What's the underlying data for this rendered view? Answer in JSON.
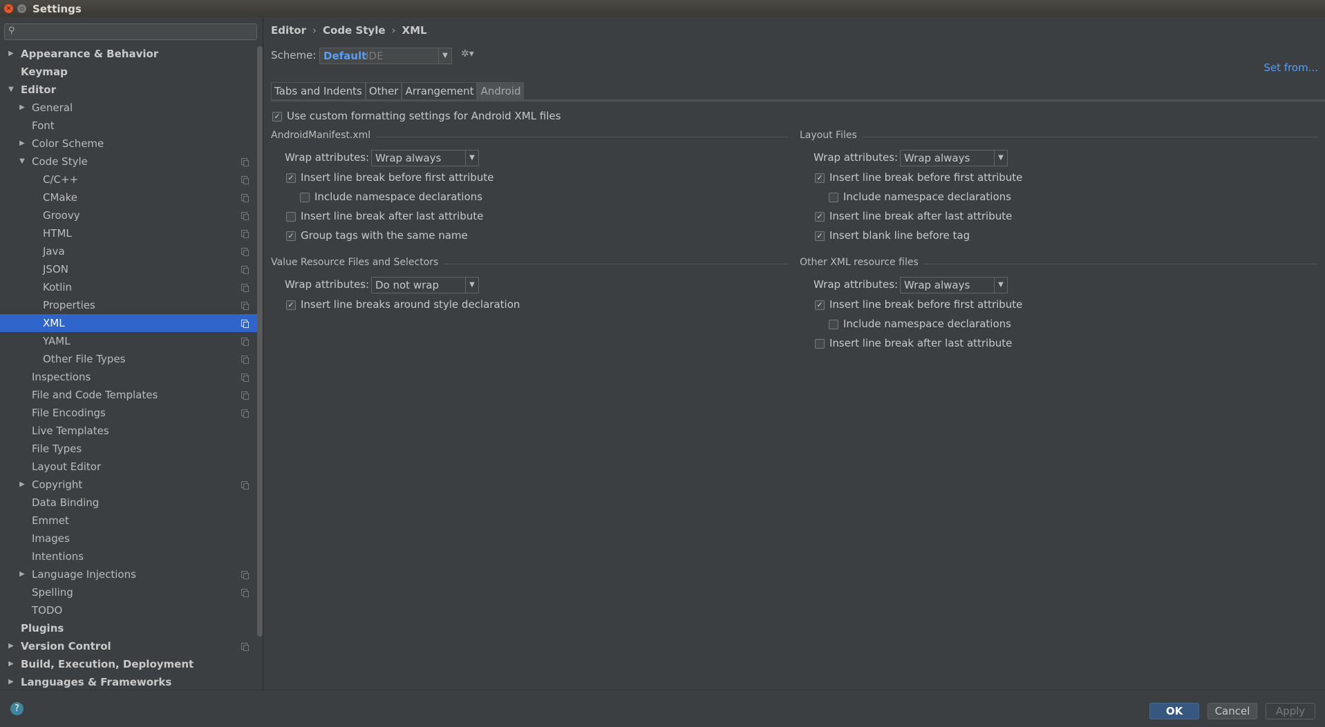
{
  "window": {
    "title": "Settings"
  },
  "search": {
    "placeholder": ""
  },
  "sidebar": {
    "items": [
      {
        "label": "Appearance & Behavior",
        "level": 0,
        "arrow": "right",
        "bold": true,
        "icon": false
      },
      {
        "label": "Keymap",
        "level": 0,
        "arrow": "",
        "bold": true,
        "icon": false
      },
      {
        "label": "Editor",
        "level": 0,
        "arrow": "down",
        "bold": true,
        "icon": false
      },
      {
        "label": "General",
        "level": 1,
        "arrow": "right",
        "bold": false,
        "icon": false
      },
      {
        "label": "Font",
        "level": 1,
        "arrow": "",
        "bold": false,
        "icon": false
      },
      {
        "label": "Color Scheme",
        "level": 1,
        "arrow": "right",
        "bold": false,
        "icon": false
      },
      {
        "label": "Code Style",
        "level": 1,
        "arrow": "down",
        "bold": false,
        "icon": true
      },
      {
        "label": "C/C++",
        "level": 2,
        "arrow": "",
        "bold": false,
        "icon": true
      },
      {
        "label": "CMake",
        "level": 2,
        "arrow": "",
        "bold": false,
        "icon": true
      },
      {
        "label": "Groovy",
        "level": 2,
        "arrow": "",
        "bold": false,
        "icon": true
      },
      {
        "label": "HTML",
        "level": 2,
        "arrow": "",
        "bold": false,
        "icon": true
      },
      {
        "label": "Java",
        "level": 2,
        "arrow": "",
        "bold": false,
        "icon": true
      },
      {
        "label": "JSON",
        "level": 2,
        "arrow": "",
        "bold": false,
        "icon": true
      },
      {
        "label": "Kotlin",
        "level": 2,
        "arrow": "",
        "bold": false,
        "icon": true
      },
      {
        "label": "Properties",
        "level": 2,
        "arrow": "",
        "bold": false,
        "icon": true
      },
      {
        "label": "XML",
        "level": 2,
        "arrow": "",
        "bold": false,
        "icon": true,
        "selected": true
      },
      {
        "label": "YAML",
        "level": 2,
        "arrow": "",
        "bold": false,
        "icon": true
      },
      {
        "label": "Other File Types",
        "level": 2,
        "arrow": "",
        "bold": false,
        "icon": true
      },
      {
        "label": "Inspections",
        "level": 1,
        "arrow": "",
        "bold": false,
        "icon": true
      },
      {
        "label": "File and Code Templates",
        "level": 1,
        "arrow": "",
        "bold": false,
        "icon": true
      },
      {
        "label": "File Encodings",
        "level": 1,
        "arrow": "",
        "bold": false,
        "icon": true
      },
      {
        "label": "Live Templates",
        "level": 1,
        "arrow": "",
        "bold": false,
        "icon": false
      },
      {
        "label": "File Types",
        "level": 1,
        "arrow": "",
        "bold": false,
        "icon": false
      },
      {
        "label": "Layout Editor",
        "level": 1,
        "arrow": "",
        "bold": false,
        "icon": false
      },
      {
        "label": "Copyright",
        "level": 1,
        "arrow": "right",
        "bold": false,
        "icon": true
      },
      {
        "label": "Data Binding",
        "level": 1,
        "arrow": "",
        "bold": false,
        "icon": false
      },
      {
        "label": "Emmet",
        "level": 1,
        "arrow": "",
        "bold": false,
        "icon": false
      },
      {
        "label": "Images",
        "level": 1,
        "arrow": "",
        "bold": false,
        "icon": false
      },
      {
        "label": "Intentions",
        "level": 1,
        "arrow": "",
        "bold": false,
        "icon": false
      },
      {
        "label": "Language Injections",
        "level": 1,
        "arrow": "right",
        "bold": false,
        "icon": true
      },
      {
        "label": "Spelling",
        "level": 1,
        "arrow": "",
        "bold": false,
        "icon": true
      },
      {
        "label": "TODO",
        "level": 1,
        "arrow": "",
        "bold": false,
        "icon": false
      },
      {
        "label": "Plugins",
        "level": 0,
        "arrow": "",
        "bold": true,
        "icon": false
      },
      {
        "label": "Version Control",
        "level": 0,
        "arrow": "right",
        "bold": true,
        "icon": true
      },
      {
        "label": "Build, Execution, Deployment",
        "level": 0,
        "arrow": "right",
        "bold": true,
        "icon": false
      },
      {
        "label": "Languages & Frameworks",
        "level": 0,
        "arrow": "right",
        "bold": true,
        "icon": false
      }
    ]
  },
  "breadcrumb": {
    "part1": "Editor",
    "sep1": "›",
    "part2": "Code Style",
    "sep2": "›",
    "part3": "XML"
  },
  "scheme": {
    "label": "Scheme:",
    "name": "Default",
    "suffix": "IDE",
    "set_from": "Set from..."
  },
  "tabs": [
    "Tabs and Indents",
    "Other",
    "Arrangement",
    "Android"
  ],
  "android": {
    "use_custom": {
      "label": "Use custom formatting settings for Android XML files",
      "checked": true
    },
    "manifest": {
      "title": "AndroidManifest.xml",
      "wrap_label": "Wrap attributes:",
      "wrap_value": "Wrap always",
      "options": [
        {
          "label": "Insert line break before first attribute",
          "checked": true,
          "indent": false
        },
        {
          "label": "Include namespace declarations",
          "checked": false,
          "indent": true
        },
        {
          "label": "Insert line break after last attribute",
          "checked": false,
          "indent": false
        },
        {
          "label": "Group tags with the same name",
          "checked": true,
          "indent": false
        }
      ]
    },
    "values": {
      "title": "Value Resource Files and Selectors",
      "wrap_label": "Wrap attributes:",
      "wrap_value": "Do not wrap",
      "options": [
        {
          "label": "Insert line breaks around style declaration",
          "checked": true,
          "indent": false
        }
      ]
    },
    "layout": {
      "title": "Layout Files",
      "wrap_label": "Wrap attributes:",
      "wrap_value": "Wrap always",
      "options": [
        {
          "label": "Insert line break before first attribute",
          "checked": true,
          "indent": false
        },
        {
          "label": "Include namespace declarations",
          "checked": false,
          "indent": true
        },
        {
          "label": "Insert line break after last attribute",
          "checked": true,
          "indent": false
        },
        {
          "label": "Insert blank line before tag",
          "checked": true,
          "indent": false
        }
      ]
    },
    "other": {
      "title": "Other XML resource files",
      "wrap_label": "Wrap attributes:",
      "wrap_value": "Wrap always",
      "options": [
        {
          "label": "Insert line break before first attribute",
          "checked": true,
          "indent": false
        },
        {
          "label": "Include namespace declarations",
          "checked": false,
          "indent": true
        },
        {
          "label": "Insert line break after last attribute",
          "checked": false,
          "indent": false
        }
      ]
    }
  },
  "footer": {
    "help": "?",
    "ok": "OK",
    "cancel": "Cancel",
    "apply": "Apply"
  },
  "colors": {
    "accent": "#589df6",
    "selection": "#2f65ca",
    "ok_button": "#365880"
  }
}
